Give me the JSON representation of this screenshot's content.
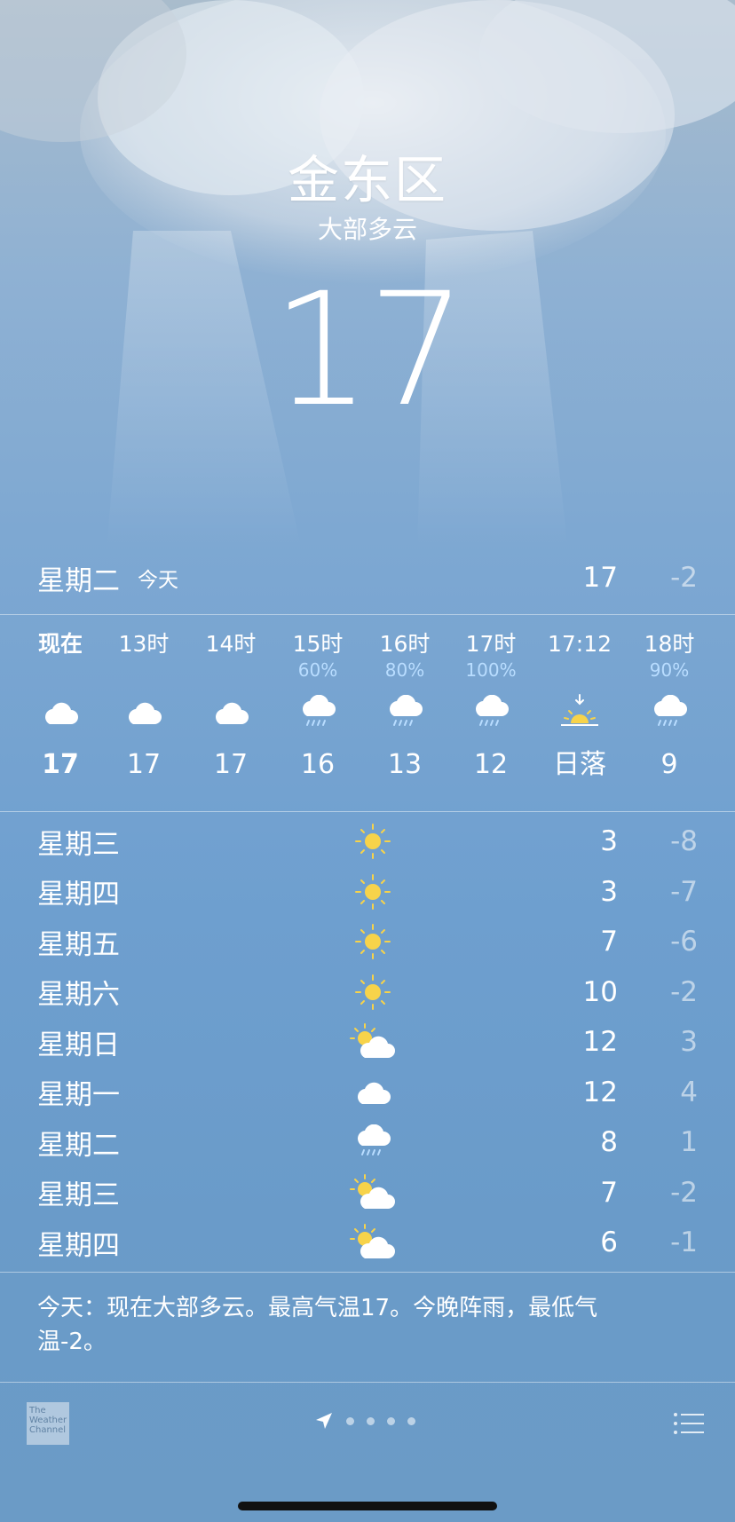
{
  "location": {
    "city": "金东区",
    "condition": "大部多云",
    "temperature": "17"
  },
  "today": {
    "day": "星期二",
    "label": "今天",
    "high": "17",
    "low": "-2"
  },
  "hourly": [
    {
      "time": "现在",
      "precip": "",
      "icon": "cloud-icon",
      "temp": "17",
      "now": true
    },
    {
      "time": "13时",
      "precip": "",
      "icon": "cloud-icon",
      "temp": "17"
    },
    {
      "time": "14时",
      "precip": "",
      "icon": "cloud-icon",
      "temp": "17"
    },
    {
      "time": "15时",
      "precip": "60%",
      "icon": "rain-cloud-icon",
      "temp": "16"
    },
    {
      "time": "16时",
      "precip": "80%",
      "icon": "rain-cloud-icon",
      "temp": "13"
    },
    {
      "time": "17时",
      "precip": "100%",
      "icon": "rain-cloud-icon",
      "temp": "12"
    },
    {
      "time": "17:12",
      "precip": "",
      "icon": "sunset-icon",
      "temp": "日落"
    },
    {
      "time": "18时",
      "precip": "90%",
      "icon": "rain-cloud-icon",
      "temp": "9"
    }
  ],
  "daily": [
    {
      "day": "星期三",
      "icon": "sun-icon",
      "high": "3",
      "low": "-8"
    },
    {
      "day": "星期四",
      "icon": "sun-icon",
      "high": "3",
      "low": "-7"
    },
    {
      "day": "星期五",
      "icon": "sun-icon",
      "high": "7",
      "low": "-6"
    },
    {
      "day": "星期六",
      "icon": "sun-icon",
      "high": "10",
      "low": "-2"
    },
    {
      "day": "星期日",
      "icon": "partly-cloudy-icon",
      "high": "12",
      "low": "3"
    },
    {
      "day": "星期一",
      "icon": "cloud-icon",
      "high": "12",
      "low": "4"
    },
    {
      "day": "星期二",
      "icon": "rain-cloud-icon",
      "high": "8",
      "low": "1"
    },
    {
      "day": "星期三",
      "icon": "partly-cloudy-icon",
      "high": "7",
      "low": "-2"
    },
    {
      "day": "星期四",
      "icon": "partly-cloudy-icon",
      "high": "6",
      "low": "-1"
    }
  ],
  "summary": "今天：现在大部多云。最高气温17。今晚阵雨，最低气温-2。",
  "footer": {
    "logo_text": "The Weather Channel",
    "page_dots": 4,
    "current_page": "location"
  },
  "colors": {
    "sun": "#f7d34a",
    "precip": "#b9ddff",
    "background_top": "#a9bccc",
    "background_bottom": "#6b9bc6"
  }
}
